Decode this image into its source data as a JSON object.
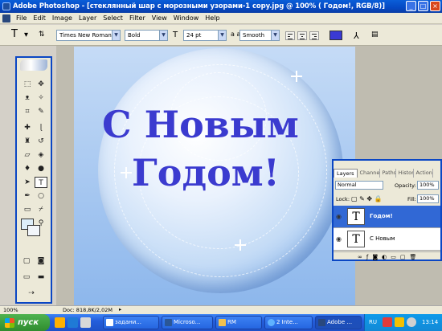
{
  "titlebar": {
    "title": "Adobe Photoshop - [стеклянный шар с морозными узорами-1 copy.jpg @ 100% ( Годом!, RGB/8)]",
    "minimize": "_",
    "maximize": "□",
    "close": "×"
  },
  "menu": [
    "File",
    "Edit",
    "Image",
    "Layer",
    "Select",
    "Filter",
    "View",
    "Window",
    "Help"
  ],
  "options": {
    "tool_glyph": "T",
    "font_family": "Times New Roman",
    "font_style": "Bold",
    "font_size": "24 pt",
    "aa_label": "a a",
    "antialias": "Smooth",
    "text_color": "#3a3ad4"
  },
  "document": {
    "line1": "С Новым",
    "line2": "Годом!",
    "text_color": "#3b3bcf"
  },
  "layers_panel": {
    "tabs": [
      "Layers",
      "Channels",
      "Paths",
      "History",
      "Actions"
    ],
    "blend_mode": "Normal",
    "opacity_label": "Opacity:",
    "opacity_value": "100%",
    "lock_label": "Lock:",
    "fill_label": "Fill:",
    "fill_value": "100%",
    "layers": [
      {
        "thumb": "T",
        "name": "Годом!",
        "active": true
      },
      {
        "thumb": "T",
        "name": "С Новым",
        "active": false
      }
    ]
  },
  "status": {
    "zoom": "100%",
    "doc_info": "Doc: 818,8K/2,02M"
  },
  "taskbar": {
    "start": "пуск",
    "buttons": [
      "задани...",
      "Microso...",
      "RM",
      "2 Inte...",
      "Adobe ..."
    ],
    "lang": "RU",
    "clock": "13:14"
  },
  "colors": {
    "titlebar": "#0549c4",
    "selection": "#3168d5",
    "taskbar": "#245edb"
  }
}
